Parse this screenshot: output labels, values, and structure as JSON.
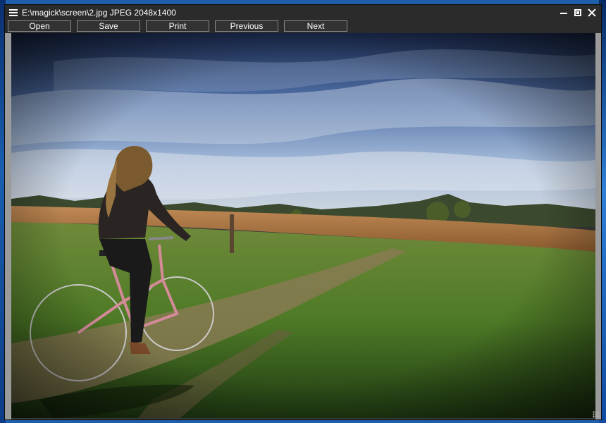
{
  "window": {
    "title": "E:\\magick\\screen\\2.jpg JPEG 2048x1400",
    "icons": {
      "menu": "hamburger-menu-icon",
      "minimize": "minimize-icon",
      "maximize": "maximize-icon",
      "close": "close-icon"
    }
  },
  "toolbar": {
    "open_label": "Open",
    "save_label": "Save",
    "print_label": "Print",
    "previous_label": "Previous",
    "next_label": "Next"
  },
  "colors": {
    "window_bg": "#2b2b2b",
    "button_border": "#8a8a8a",
    "desktop_bg": "#1f5ea8"
  }
}
